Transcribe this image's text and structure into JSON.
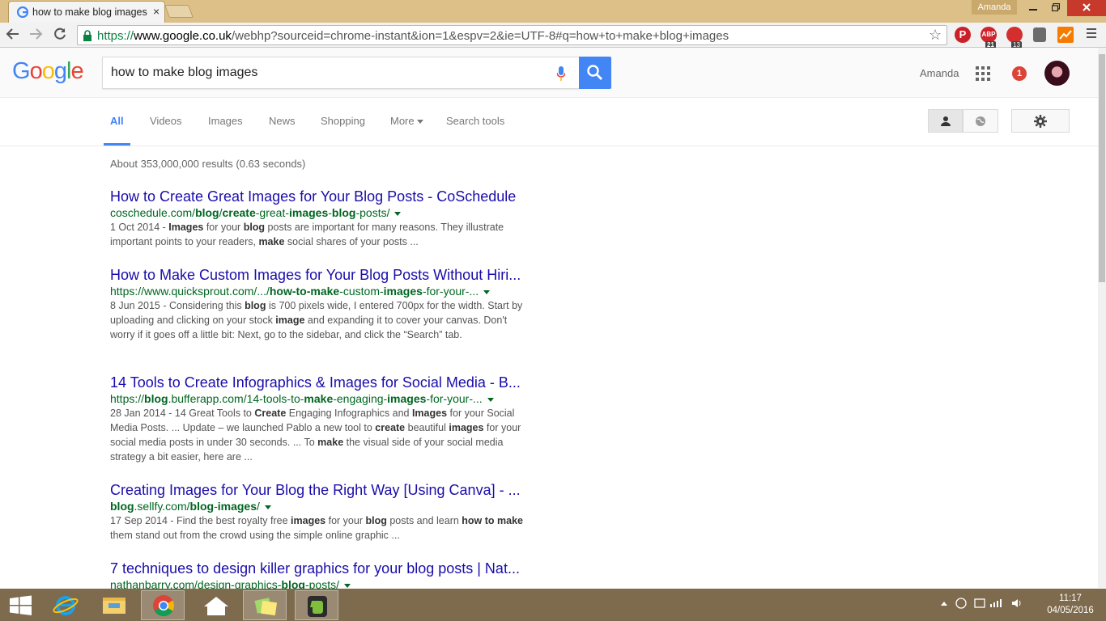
{
  "browser": {
    "tab_title": "how to make blog images",
    "close_glyph": "×",
    "user_label": "Amanda",
    "url": {
      "scheme": "https://",
      "host": "www.google.co.uk",
      "rest": "/webhp?sourceid=chrome-instant&ion=1&espv=2&ie=UTF-8#q=how+to+make+blog+images"
    },
    "extensions": {
      "pinterest": "P",
      "abp": "ABP",
      "abp_count": "21",
      "ublock_count": "13"
    }
  },
  "google": {
    "logo": [
      "G",
      "o",
      "o",
      "g",
      "l",
      "e"
    ],
    "logo_colors": [
      "#4285f4",
      "#ea4335",
      "#fbbc05",
      "#4285f4",
      "#34a853",
      "#ea4335"
    ],
    "query": "how to make blog images",
    "user": "Amanda",
    "notifications": "1"
  },
  "tabs": [
    "All",
    "Videos",
    "Images",
    "News",
    "Shopping",
    "More",
    "Search tools"
  ],
  "stats": "About 353,000,000 results (0.63 seconds)",
  "results": [
    {
      "title": "How to Create Great Images for Your Blog Posts - CoSchedule",
      "url_html": "coschedule.com/<b>blog</b>/<b>create</b>-great-<b>images</b>-<b>blog</b>-posts/",
      "snippet_html": "1 Oct 2014 - <b>Images</b> for your <b>blog</b> posts are important for many reasons. They illustrate important points to your readers, <b>make</b> social shares of your posts ..."
    },
    {
      "title": "How to Make Custom Images for Your Blog Posts Without Hiri...",
      "url_html": "https://www.quicksprout.com/.../<b>how-to-make</b>-custom-<b>images</b>-for-your-...",
      "snippet_html": "8 Jun 2015 - Considering this <b>blog</b> is 700 pixels wide, I entered 700px for the width. Start by uploading and clicking on your stock <b>image</b> and expanding it to cover your canvas. Don't worry if it goes off a little bit: Next, go to the sidebar, and click the “Search” tab."
    },
    {
      "title": "14 Tools to Create Infographics & Images for Social Media - B...",
      "url_html": "https://<b>blog</b>.bufferapp.com/14-tools-to-<b>make</b>-engaging-<b>images</b>-for-your-...",
      "snippet_html": "28 Jan 2014 - 14 Great Tools to <b>Create</b> Engaging Infographics and <b>Images</b> for your Social Media Posts. ... Update – we launched Pablo a new tool to <b>create</b> beautiful <b>images</b> for your social media posts in under 30 seconds. ... To <b>make</b> the visual side of your social media strategy a bit easier, here are ..."
    },
    {
      "title": "Creating Images for Your Blog the Right Way [Using Canva] - ...",
      "url_html": "<b>blog</b>.sellfy.com/<b>blog</b>-<b>images</b>/",
      "snippet_html": "17 Sep 2014 - Find the best royalty free <b>images</b> for your <b>blog</b> posts and learn <b>how to make</b> them stand out from the crowd using the simple online graphic ..."
    },
    {
      "title": "7 techniques to design killer graphics for your blog posts | Nat...",
      "url_html": "nathanbarry.com/design-graphics-<b>blog</b>-posts/",
      "snippet_html": ""
    }
  ],
  "taskbar": {
    "time": "11:17",
    "date": "04/05/2016"
  }
}
